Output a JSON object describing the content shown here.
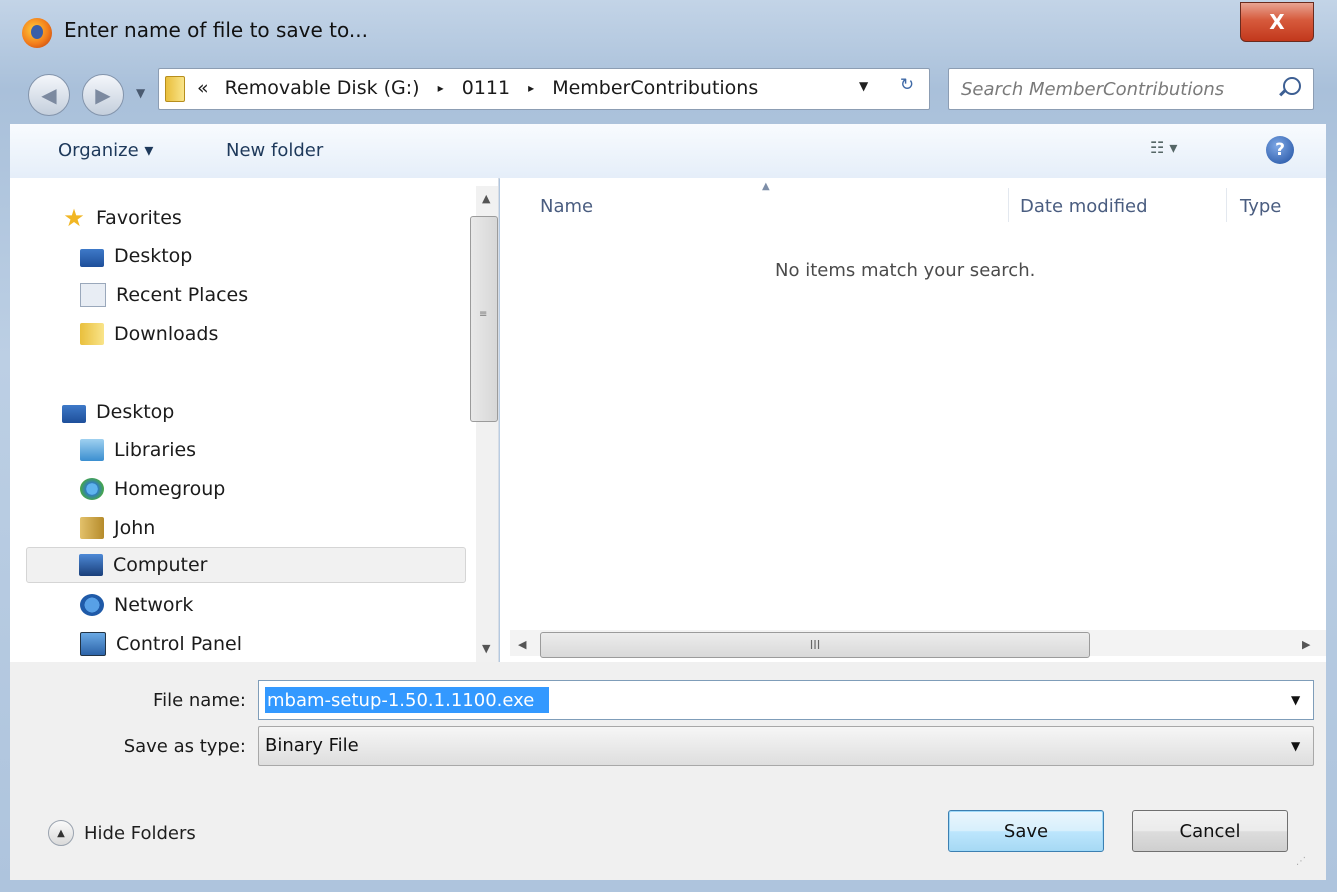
{
  "window": {
    "title": "Enter name of file to save to...",
    "close_label": "X"
  },
  "address": {
    "overflow": "«",
    "crumbs": [
      "Removable Disk (G:)",
      "0111",
      "MemberContributions"
    ],
    "separator": "▸"
  },
  "search": {
    "placeholder": "Search MemberContributions"
  },
  "toolbar": {
    "organize_label": "Organize ▾",
    "new_folder_label": "New folder",
    "views_label": "☷ ▾",
    "help_label": "?"
  },
  "nav": {
    "favorites": [
      {
        "label": "Favorites",
        "icon": "star-icon"
      },
      {
        "label": "Desktop",
        "icon": "desktop-icon"
      },
      {
        "label": "Recent Places",
        "icon": "recent-places-icon"
      },
      {
        "label": "Downloads",
        "icon": "downloads-icon"
      }
    ],
    "tree": [
      {
        "label": "Desktop",
        "icon": "desktop-icon"
      },
      {
        "label": "Libraries",
        "icon": "libraries-icon"
      },
      {
        "label": "Homegroup",
        "icon": "homegroup-icon"
      },
      {
        "label": "John",
        "icon": "user-folder-icon"
      },
      {
        "label": "Computer",
        "icon": "computer-icon",
        "selected": true
      },
      {
        "label": "Network",
        "icon": "network-icon"
      },
      {
        "label": "Control Panel",
        "icon": "control-panel-icon"
      }
    ]
  },
  "filelist": {
    "columns": [
      "Name",
      "Date modified",
      "Type"
    ],
    "empty_message": "No items match your search.",
    "hscroll_grip": "III"
  },
  "form": {
    "file_name_label": "File name:",
    "file_name_value": "mbam-setup-1.50.1.1100.exe",
    "save_as_type_label": "Save as type:",
    "save_as_type_value": "Binary File"
  },
  "footer": {
    "hide_folders_label": "Hide Folders",
    "save_label": "Save",
    "cancel_label": "Cancel"
  },
  "colors": {
    "selection": "#3399ff",
    "close_button": "#c2381c",
    "column_header_text": "#4a5d80"
  }
}
